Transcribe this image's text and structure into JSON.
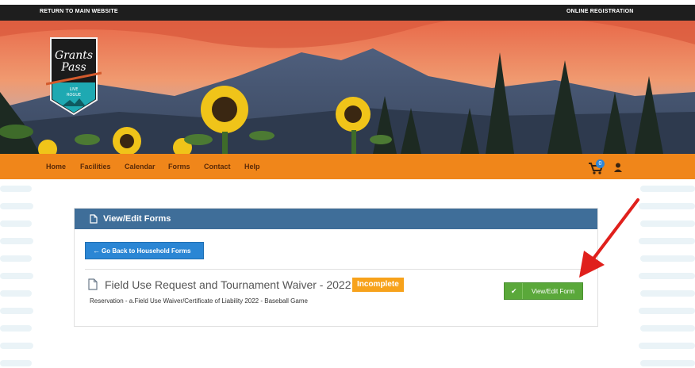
{
  "topbar": {
    "left_link": "RETURN TO MAIN WEBSITE",
    "right_link": "ONLINE REGISTRATION"
  },
  "logo": {
    "script_text": "Grants Pass",
    "tagline": "LIVE ROGUE"
  },
  "nav": {
    "items": [
      "Home",
      "Facilities",
      "Calendar",
      "Forms",
      "Contact",
      "Help"
    ],
    "cart_count": "0"
  },
  "panel": {
    "title": "View/Edit Forms",
    "back_button": "Go Back to Household Forms",
    "form_title": "Field Use Request and Tournament Waiver - 2022",
    "status": "Incomplete",
    "form_subtitle": "Reservation - a.Field Use Waiver/Certificate of Liability 2022 - Baseball Game",
    "view_button": "View/Edit Form"
  },
  "colors": {
    "nav_bg": "#f0861a",
    "panel_header": "#3f6e99",
    "back_button": "#2b86d4",
    "status_badge": "#f7a21b",
    "view_button": "#5aa83a",
    "annotation_arrow": "#e0201c"
  }
}
